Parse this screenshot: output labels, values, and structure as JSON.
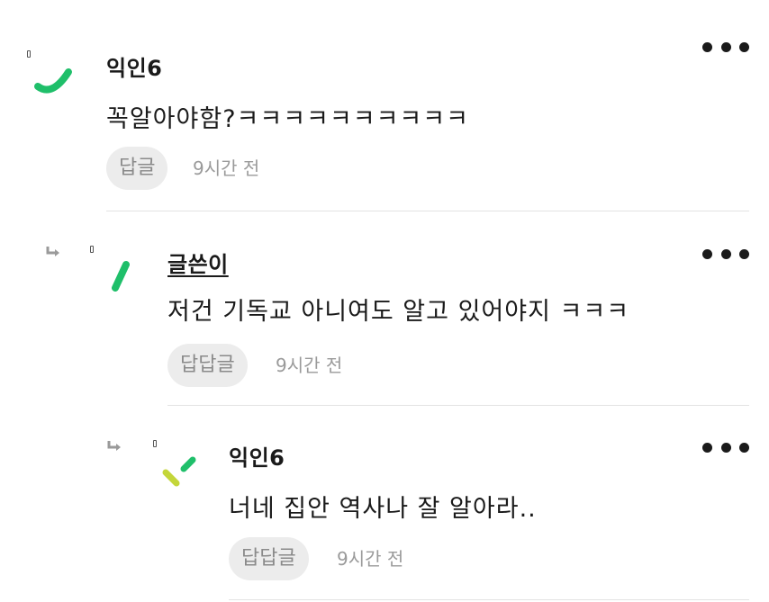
{
  "comments": [
    {
      "nickname": "익인6",
      "text": "꼭알아야함?ㅋㅋㅋㅋㅋㅋㅋㅋㅋㅋ",
      "reply_label": "답글",
      "time": "9시간 전"
    },
    {
      "nickname": "글쓴이",
      "text": "저건 기독교 아니여도 알고 있어야지 ㅋㅋㅋ",
      "reply_label": "답답글",
      "time": "9시간 전"
    },
    {
      "nickname": "익인6",
      "text": "너네 집안 역사나 잘 알아라..",
      "reply_label": "답답글",
      "time": "9시간 전"
    }
  ],
  "colors": {
    "avatar_green": "#1fbf6a",
    "avatar_lime": "#c4d63a",
    "reply_button_bg": "#ececec",
    "meta_gray": "#9a9a9a"
  },
  "icons": {
    "more": "more-options-icon",
    "reply_arrow": "reply-arrow-icon"
  }
}
